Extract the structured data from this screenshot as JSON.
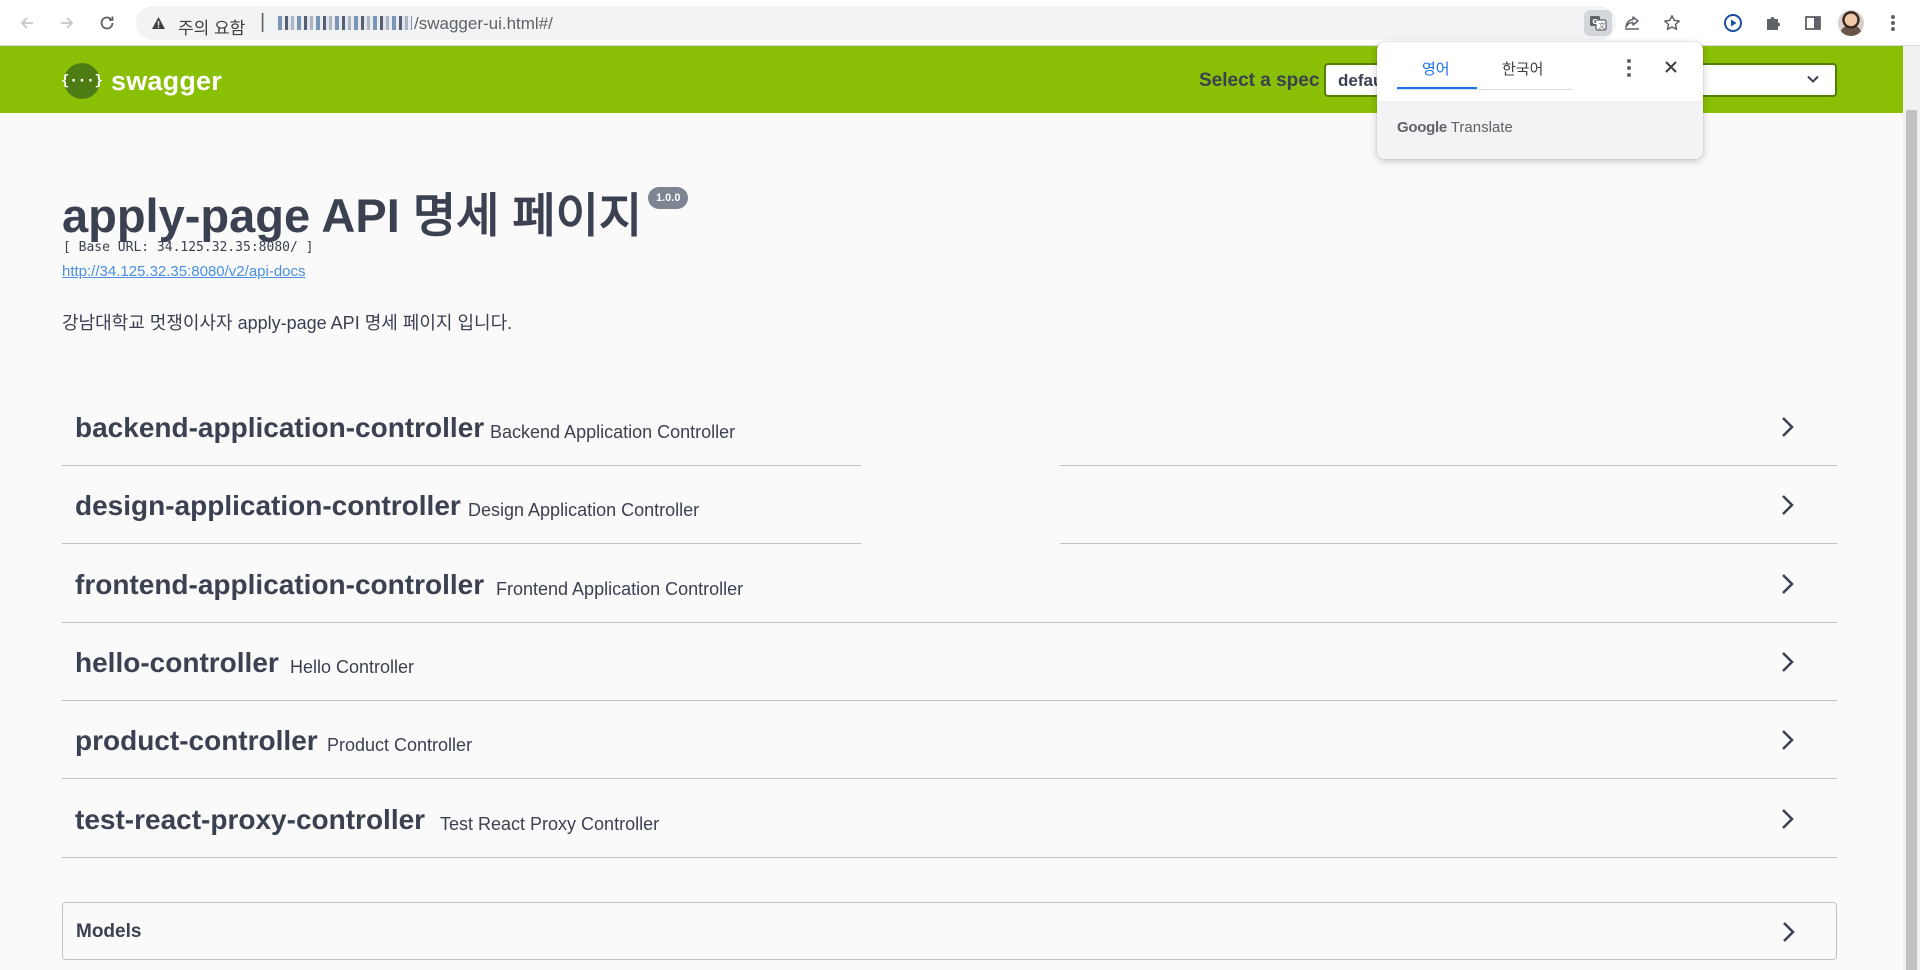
{
  "browser": {
    "warning_text": "주의 요함",
    "separator": "|",
    "url_path": "/swagger-ui.html#/"
  },
  "header": {
    "logo_glyph": "{···}",
    "logo_text": "swagger",
    "spec_label": "Select a spec",
    "spec_value": "defau"
  },
  "translate_popup": {
    "tab_source": "영어",
    "tab_target": "한국어",
    "brand_google": "Google",
    "brand_translate": "Translate"
  },
  "info": {
    "title": "apply-page API 명세 페이지",
    "version": "1.0.0",
    "base_url": "[ Base URL: 34.125.32.35:8080/ ]",
    "docs_link": "http://34.125.32.35:8080/v2/api-docs",
    "description": "강남대학교 멋쟁이사자 apply-page API 명세 페이지 입니다."
  },
  "controllers": [
    {
      "name": "backend-application-controller",
      "description": "Backend Application Controller"
    },
    {
      "name": "design-application-controller",
      "description": "Design Application Controller"
    },
    {
      "name": "frontend-application-controller",
      "description": "Frontend Application Controller"
    },
    {
      "name": "hello-controller",
      "description": "Hello Controller"
    },
    {
      "name": "product-controller",
      "description": "Product Controller"
    },
    {
      "name": "test-react-proxy-controller",
      "description": "Test React Proxy Controller"
    }
  ],
  "models": {
    "label": "Models"
  },
  "colors": {
    "topbar": "#89bf04",
    "text": "#3b4151",
    "link": "#4990e2",
    "translate_accent": "#1a73e8"
  }
}
